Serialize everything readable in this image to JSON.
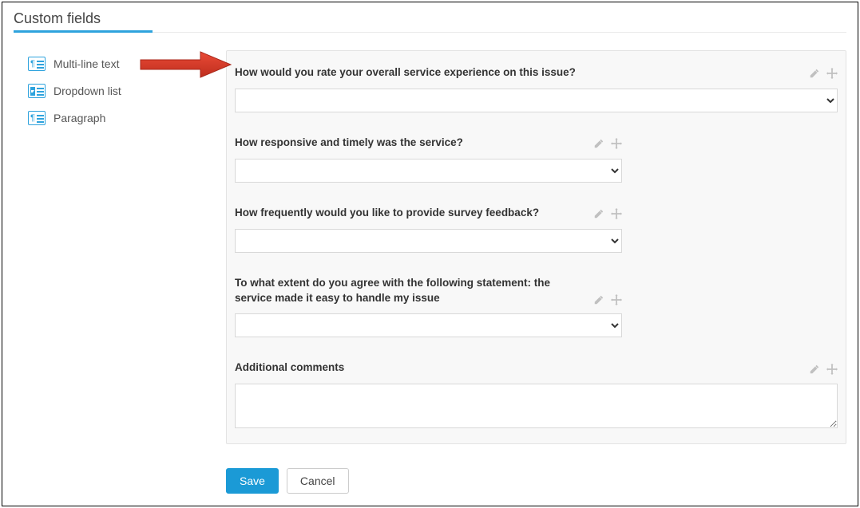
{
  "header": {
    "title": "Custom fields"
  },
  "sidebar": {
    "items": [
      {
        "label": "Multi-line text",
        "icon": "multiline-text-icon"
      },
      {
        "label": "Dropdown list",
        "icon": "dropdown-list-icon"
      },
      {
        "label": "Paragraph",
        "icon": "paragraph-icon"
      }
    ]
  },
  "form": {
    "fields": [
      {
        "type": "select",
        "width": "wide",
        "question": "How would you rate your overall service experience on this issue?",
        "value": ""
      },
      {
        "type": "select",
        "width": "narrow",
        "question": "How responsive and timely was the service?",
        "value": ""
      },
      {
        "type": "select",
        "width": "narrow",
        "question": "How frequently would you like to provide survey feedback?",
        "value": ""
      },
      {
        "type": "select",
        "width": "narrow",
        "question": "To what extent do you agree with the following statement: the service made it easy to handle my issue",
        "value": ""
      },
      {
        "type": "textarea",
        "width": "wide",
        "question": "Additional comments",
        "value": ""
      }
    ]
  },
  "buttons": {
    "save": "Save",
    "cancel": "Cancel"
  },
  "annotation": {
    "arrow_color": "#d63b2a",
    "target": "sidebar.items.0"
  }
}
